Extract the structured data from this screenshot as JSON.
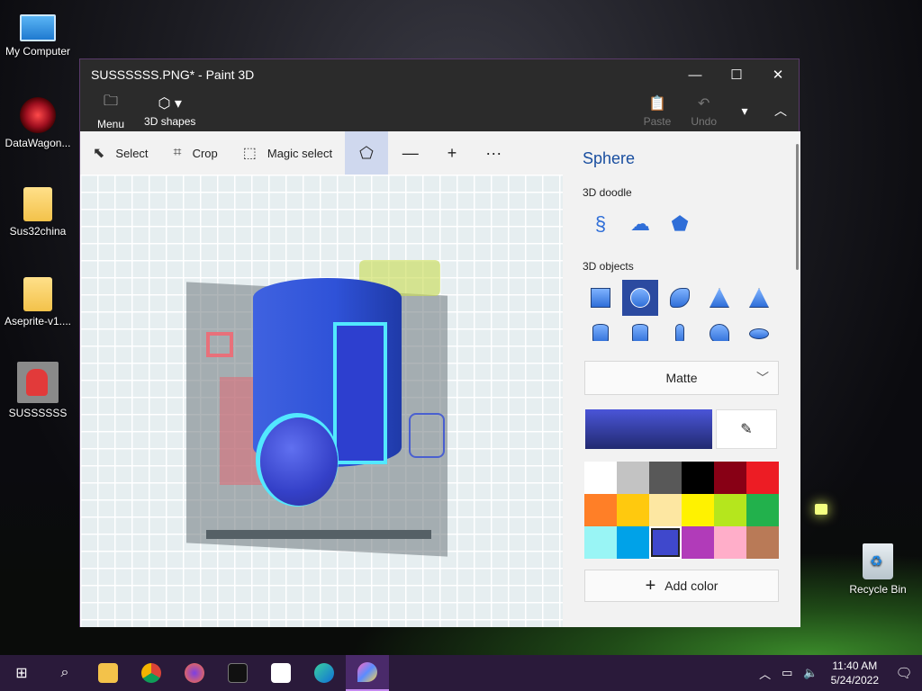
{
  "desktop": {
    "icons": [
      {
        "label": "My Computer"
      },
      {
        "label": "DataWagon..."
      },
      {
        "label": "Sus32china"
      },
      {
        "label": "Aseprite-v1...."
      },
      {
        "label": "SUSSSSSS"
      },
      {
        "label": "Recycle Bin"
      }
    ]
  },
  "window": {
    "title": "SUSSSSSS.PNG* - Paint 3D",
    "controls": {
      "minimize": "—",
      "maximize": "☐",
      "close": "✕"
    },
    "ribbon": {
      "menu": "Menu",
      "shapes3d": "3D shapes",
      "paste": "Paste",
      "undo": "Undo"
    },
    "toolbar": {
      "select": "Select",
      "crop": "Crop",
      "magic_select": "Magic select"
    },
    "panel": {
      "title": "Sphere",
      "doodle_heading": "3D doodle",
      "objects_heading": "3D objects",
      "material": "Matte",
      "add_color": "Add color",
      "current_color": "#3d48c8",
      "palette": [
        "#ffffff",
        "#c3c3c3",
        "#585858",
        "#000000",
        "#880015",
        "#ed1c24",
        "#ff7f27",
        "#ffc90e",
        "#fde7a2",
        "#fff200",
        "#b5e61d",
        "#22b14c",
        "#99f5f5",
        "#00a2e8",
        "#3f48cc",
        "#b13bb9",
        "#ffaec9",
        "#b97a57"
      ],
      "selected_swatch": 14
    }
  },
  "taskbar": {
    "time": "11:40 AM",
    "date": "5/24/2022"
  }
}
